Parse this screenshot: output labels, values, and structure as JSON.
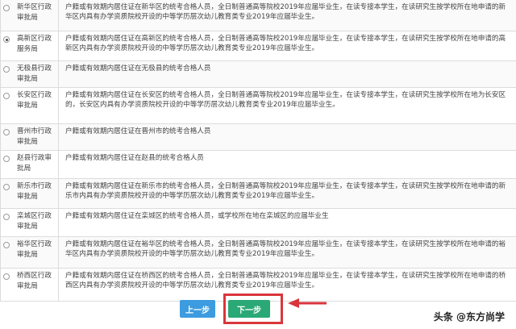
{
  "rows": [
    {
      "name": "新华区行政审批局",
      "selected": false,
      "desc": "户籍或有效期内居住证在新华区的统考合格人员，全日制普通高等院校2019年应届毕业生，在读专接本学生，在读研究生按学校所在地申请的新华区内具有办学资质院校开设的中等学历层次幼儿教育类专业2019年应届毕业生。"
    },
    {
      "name": "高新区行政服务局",
      "selected": true,
      "desc": "户籍或有效期内居住证在高新区的统考合格人员，全日制普通高等院校2019年应届毕业生，在读专接本学生，在读研究生按学校所在地申请的高新区内具有办学资质院校开设的中等学历层次幼儿教育类专业2019年应届毕业生。"
    },
    {
      "name": "无极县行政审批局",
      "selected": false,
      "desc": "户籍或有效期内居住证在无极县的统考合格人员"
    },
    {
      "name": "长安区行政审批局",
      "selected": false,
      "desc": "户籍或有效期内居住证在长安区的统考合格人员，全日制普通高等院校2019年应届毕业生，在读专接本学生，在读研究生按学校所在地为长安区的，长安区内具有办学资质院校开设的中等学历层次幼儿教育类专业2019年应届毕业生。"
    },
    {
      "name": "晋州市行政审批局",
      "selected": false,
      "desc": "户籍或有效期内居住证在晋州市的统考合格人员"
    },
    {
      "name": "赵县行政审批局",
      "selected": false,
      "desc": "户籍或有效期内居住证在赵县的统考合格人员"
    },
    {
      "name": "新乐市行政审批局",
      "selected": false,
      "desc": "户籍或有效期内居住证在新乐市的统考合格人员，全日制普通高等院校2019年应届毕业生，在读专接本学生，在读研究生按学校所在地申请的新乐市内具有办学资质院校开设的中等学历层次幼儿教育类专业2019年应届毕业生。"
    },
    {
      "name": "栾城区行政审批局",
      "selected": false,
      "desc": "户籍或有效期内居住证在栾城区的统考合格人员，或学校所在地在栾城区的应届毕业生"
    },
    {
      "name": "裕华区行政审批局",
      "selected": false,
      "desc": "户籍或有效期内居住证在裕华区的统考合格人员，全日制普通高等院校2019年应届毕业生，在读专接本学生，在读研究生按学校所在地申请的裕华区内具有办学资质院校开设的中等学历层次幼儿教育类专业2019年应届毕业生。"
    },
    {
      "name": "桥西区行政审批局",
      "selected": false,
      "desc": "户籍或有效期内居住证在桥西区的统考合格人员，全日制普通高等院校2019年应届毕业生，在读专接本学生，在读研究生按学校所在地申请的桥西区内具有办学资质院校开设的中等学历层次幼儿教育类专业2019年应届毕业生。"
    }
  ],
  "buttons": {
    "prev_label": "上一步",
    "next_label": "下一步"
  },
  "watermark": "头条 @东方尚学",
  "colors": {
    "prev": "#3d9be0",
    "next": "#2aa876",
    "highlight": "#d9363c"
  }
}
